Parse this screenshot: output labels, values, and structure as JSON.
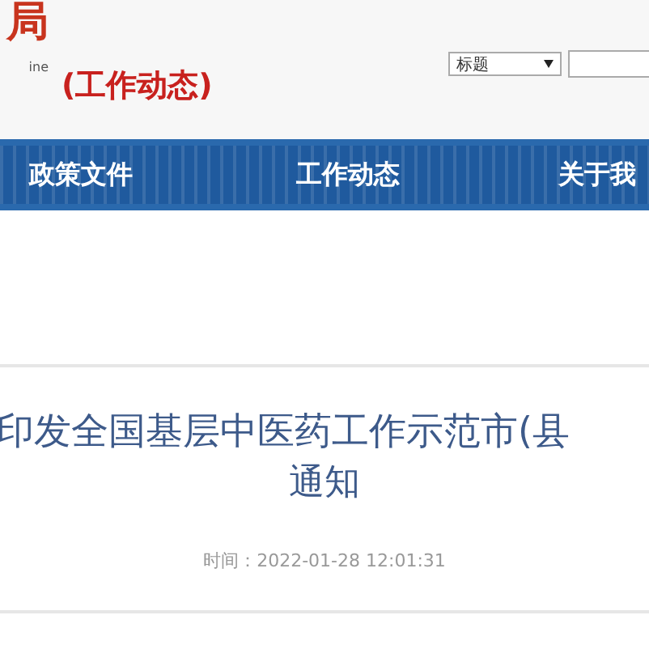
{
  "header": {
    "logo_char": "局",
    "logo_subtext": "ine",
    "section_title": "(工作动态)",
    "search": {
      "scope": "标题"
    }
  },
  "nav": {
    "items": [
      {
        "label": "政策文件"
      },
      {
        "label": "工作动态"
      },
      {
        "label": "关于我"
      }
    ]
  },
  "article": {
    "title_lines": [
      "印发全国基层中医药工作示范市(县",
      "通知"
    ],
    "time": "时间：2022-01-28 12:01:31"
  }
}
